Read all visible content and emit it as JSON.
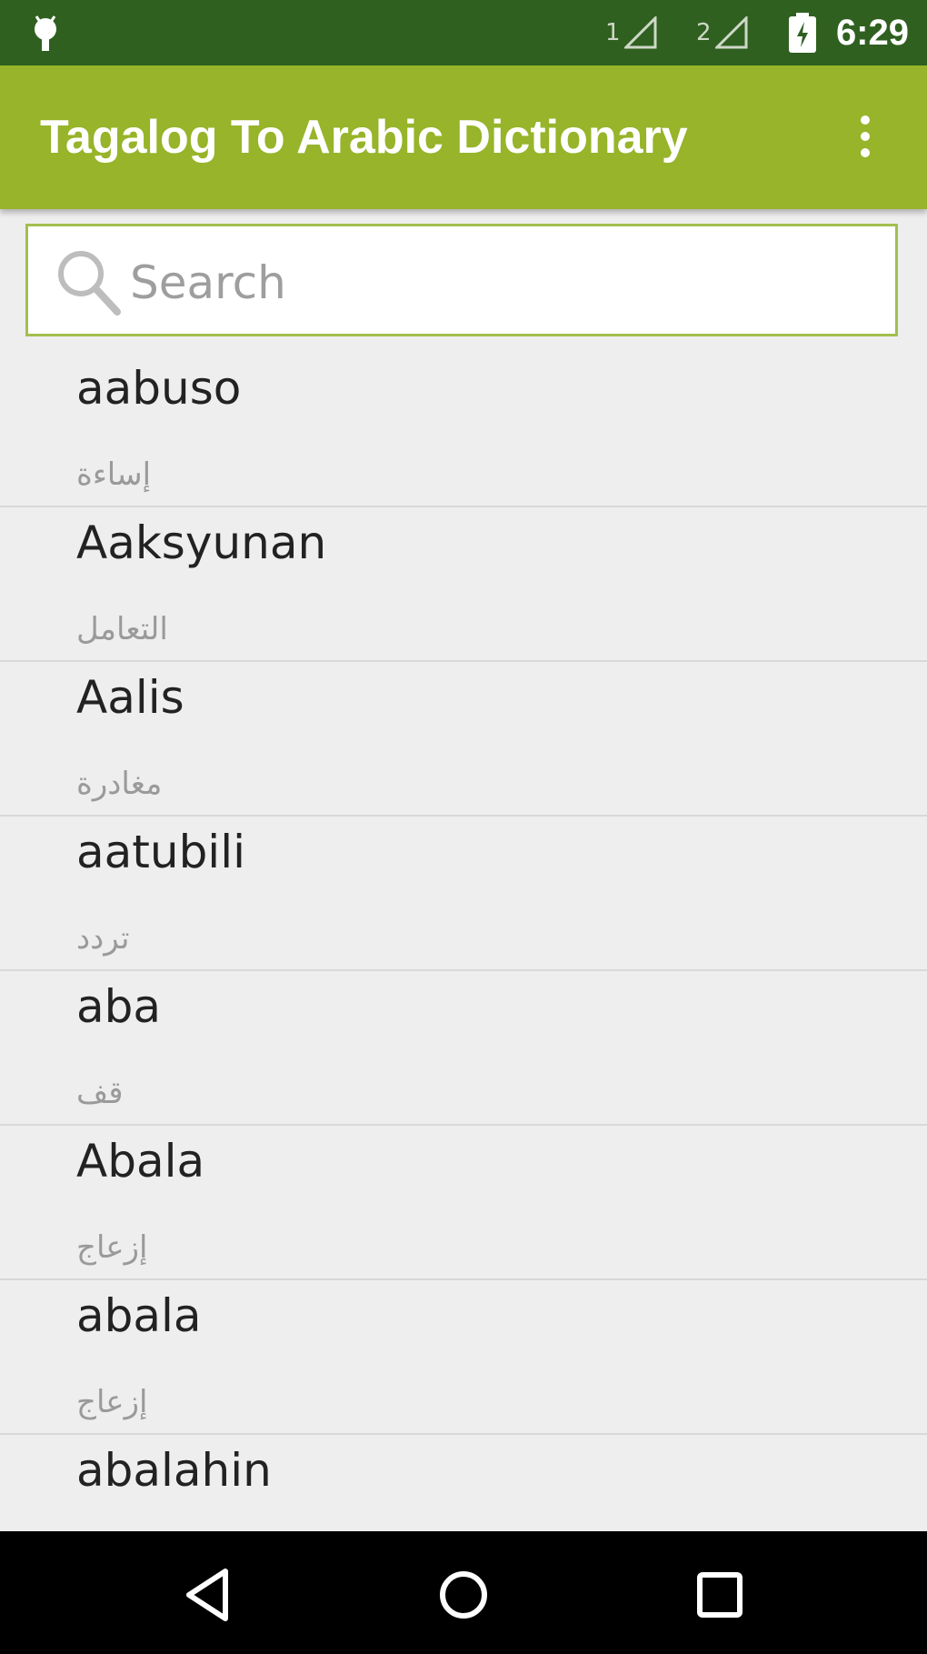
{
  "status_bar": {
    "sim1_label": "1",
    "sim2_label": "2",
    "time": "6:29",
    "icons": [
      "android-notification-icon",
      "signal-1-icon",
      "signal-2-icon",
      "battery-charging-icon"
    ]
  },
  "app_bar": {
    "title": "Tagalog To Arabic Dictionary",
    "menu_icon": "overflow-menu-icon"
  },
  "search": {
    "placeholder": "Search",
    "value": "",
    "icon": "search-icon"
  },
  "entries": [
    {
      "word": "aabuso",
      "translation": "إساءة"
    },
    {
      "word": "Aaksyunan",
      "translation": "التعامل"
    },
    {
      "word": "Aalis",
      "translation": "مغادرة"
    },
    {
      "word": "aatubili",
      "translation": "تردد"
    },
    {
      "word": "aba",
      "translation": "قف"
    },
    {
      "word": "Abala",
      "translation": "إزعاج"
    },
    {
      "word": "abala",
      "translation": "إزعاج"
    },
    {
      "word": "abalahin",
      "translation": ""
    }
  ],
  "nav_bar": {
    "icons": [
      "back-icon",
      "home-icon",
      "recents-icon"
    ]
  },
  "colors": {
    "status_bar": "#2f6020",
    "app_bar": "#97b42a",
    "search_border": "#a3bf4e",
    "background": "#eeeeee"
  }
}
